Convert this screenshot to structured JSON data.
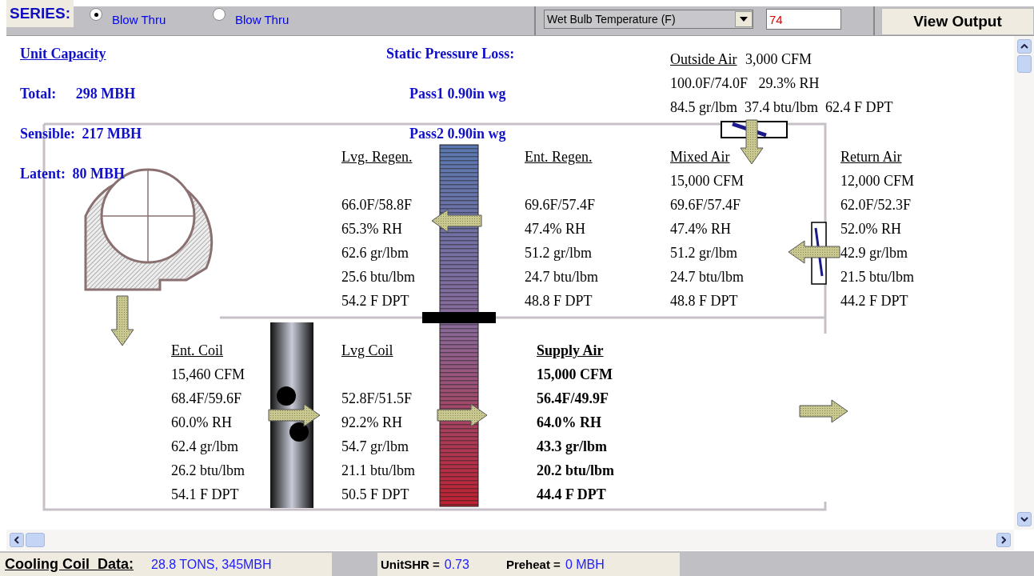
{
  "top_bar": {
    "series_label": "SERIES:",
    "options": [
      {
        "label": "Blow Thru",
        "selected": true
      },
      {
        "label": "Blow Thru",
        "selected": false
      }
    ],
    "dropdown": {
      "value": "Wet Bulb Temperature (F)"
    },
    "input": {
      "value": "74"
    },
    "button": "View Output"
  },
  "capacity": {
    "title": "Unit Capacity",
    "rows": [
      {
        "label": "Total:",
        "value": "298 MBH"
      },
      {
        "label": "Sensible:",
        "value": "217 MBH"
      },
      {
        "label": "Latent:",
        "value": "80 MBH"
      }
    ]
  },
  "static_pressure": {
    "title": "Static Pressure Loss:",
    "rows": [
      "Pass1 0.90in wg",
      "Pass2 0.90in wg"
    ]
  },
  "outside_air": {
    "title": "Outside Air",
    "cfm": "3,000 CFM",
    "lines": [
      "100.0F/74.0F   29.3% RH",
      "84.5 gr/lbm  37.4 btu/lbm  62.4 F DPT"
    ]
  },
  "upper_states": [
    {
      "title": "Lvg. Regen.",
      "bold": false,
      "values": [
        "66.0F/58.8F",
        "65.3% RH",
        "62.6 gr/lbm",
        "25.6 btu/lbm",
        "54.2 F DPT"
      ]
    },
    {
      "title": "Ent. Regen.",
      "bold": false,
      "values": [
        "69.6F/57.4F",
        "47.4% RH",
        "51.2 gr/lbm",
        "24.7 btu/lbm",
        "48.8 F DPT"
      ]
    },
    {
      "title": "Mixed Air",
      "bold": false,
      "cfm": "15,000 CFM",
      "values": [
        "69.6F/57.4F",
        "47.4% RH",
        "51.2 gr/lbm",
        "24.7 btu/lbm",
        "48.8 F DPT"
      ]
    },
    {
      "title": "Return Air",
      "bold": false,
      "cfm": "12,000 CFM",
      "values": [
        "62.0F/52.3F",
        "52.0% RH",
        "42.9 gr/lbm",
        "21.5 btu/lbm",
        "44.2 F DPT"
      ]
    }
  ],
  "lower_states": [
    {
      "title": "Ent. Coil",
      "bold": false,
      "cfm": "15,460 CFM",
      "values": [
        "68.4F/59.6F",
        "60.0% RH",
        "62.4 gr/lbm",
        "26.2 btu/lbm",
        "54.1 F DPT"
      ]
    },
    {
      "title": "Lvg Coil",
      "bold": false,
      "values": [
        "52.8F/51.5F",
        "92.2% RH",
        "54.7 gr/lbm",
        "21.1 btu/lbm",
        "50.5 F DPT"
      ]
    },
    {
      "title": "Supply Air",
      "bold": true,
      "cfm": "15,000 CFM",
      "values": [
        "56.4F/49.9F",
        "64.0% RH",
        "43.3 gr/lbm",
        "20.2 btu/lbm",
        "44.4 F DPT"
      ]
    }
  ],
  "status_bar": {
    "label": "Cooling Coil  Data:",
    "coil_value": "28.8 TONS, 345MBH",
    "shr_label": "UnitSHR =",
    "shr_value": "0.73",
    "preheat_label": "Preheat =",
    "preheat_value": "0 MBH"
  }
}
